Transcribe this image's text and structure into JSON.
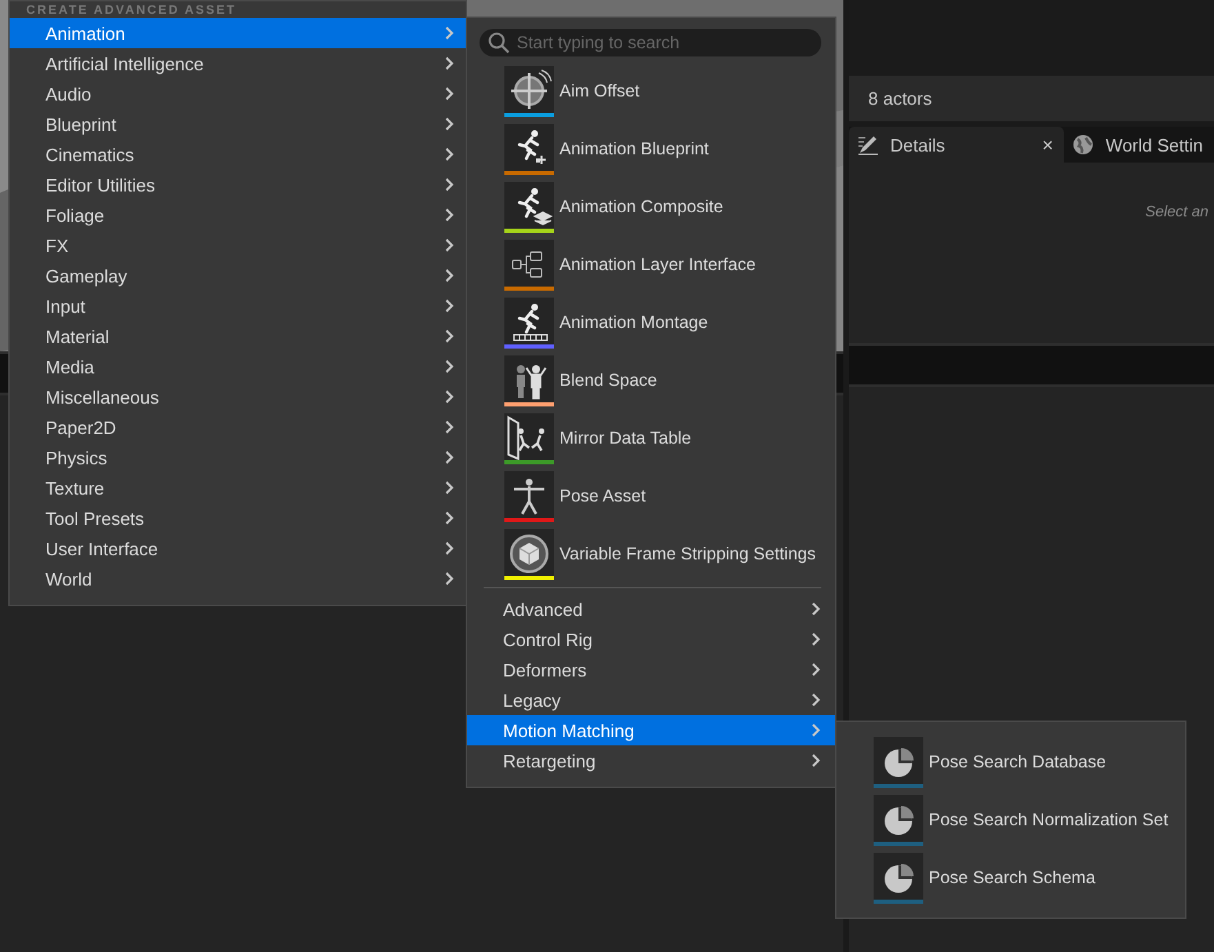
{
  "outliner": {
    "count": "8 actors"
  },
  "details_tabs": [
    {
      "label": "Details",
      "selected": true,
      "close": "×"
    },
    {
      "label": "World Settin",
      "selected": false
    }
  ],
  "details": {
    "hint": "Select an"
  },
  "menu": {
    "header": "CREATE ADVANCED ASSET",
    "items": [
      {
        "label": "Animation",
        "selected": true
      },
      {
        "label": "Artificial Intelligence",
        "selected": false
      },
      {
        "label": "Audio",
        "selected": false
      },
      {
        "label": "Blueprint",
        "selected": false
      },
      {
        "label": "Cinematics",
        "selected": false
      },
      {
        "label": "Editor Utilities",
        "selected": false
      },
      {
        "label": "Foliage",
        "selected": false
      },
      {
        "label": "FX",
        "selected": false
      },
      {
        "label": "Gameplay",
        "selected": false
      },
      {
        "label": "Input",
        "selected": false
      },
      {
        "label": "Material",
        "selected": false
      },
      {
        "label": "Media",
        "selected": false
      },
      {
        "label": "Miscellaneous",
        "selected": false
      },
      {
        "label": "Paper2D",
        "selected": false
      },
      {
        "label": "Physics",
        "selected": false
      },
      {
        "label": "Texture",
        "selected": false
      },
      {
        "label": "Tool Presets",
        "selected": false
      },
      {
        "label": "User Interface",
        "selected": false
      },
      {
        "label": "World",
        "selected": false
      }
    ]
  },
  "submenu": {
    "search": {
      "placeholder": "Start typing to search"
    },
    "assets": [
      {
        "label": "Aim Offset",
        "color": "#0a9ee0"
      },
      {
        "label": "Animation Blueprint",
        "color": "#c86a00"
      },
      {
        "label": "Animation Composite",
        "color": "#a6d41a"
      },
      {
        "label": "Animation Layer Interface",
        "color": "#c86a00"
      },
      {
        "label": "Animation Montage",
        "color": "#6060ff"
      },
      {
        "label": "Blend Space",
        "color": "#ffa070"
      },
      {
        "label": "Mirror Data Table",
        "color": "#3c9a28"
      },
      {
        "label": "Pose Asset",
        "color": "#e01818"
      },
      {
        "label": "Variable Frame Stripping Settings",
        "color": "#f0f000"
      }
    ],
    "categories": [
      {
        "label": "Advanced",
        "selected": false
      },
      {
        "label": "Control Rig",
        "selected": false
      },
      {
        "label": "Deformers",
        "selected": false
      },
      {
        "label": "Legacy",
        "selected": false
      },
      {
        "label": "Motion Matching",
        "selected": true
      },
      {
        "label": "Retargeting",
        "selected": false
      }
    ]
  },
  "flyout": {
    "assets": [
      {
        "label": "Pose Search Database",
        "color": "#1e5f80"
      },
      {
        "label": "Pose Search Normalization Set",
        "color": "#1e5f80"
      },
      {
        "label": "Pose Search Schema",
        "color": "#1e5f80"
      }
    ]
  }
}
